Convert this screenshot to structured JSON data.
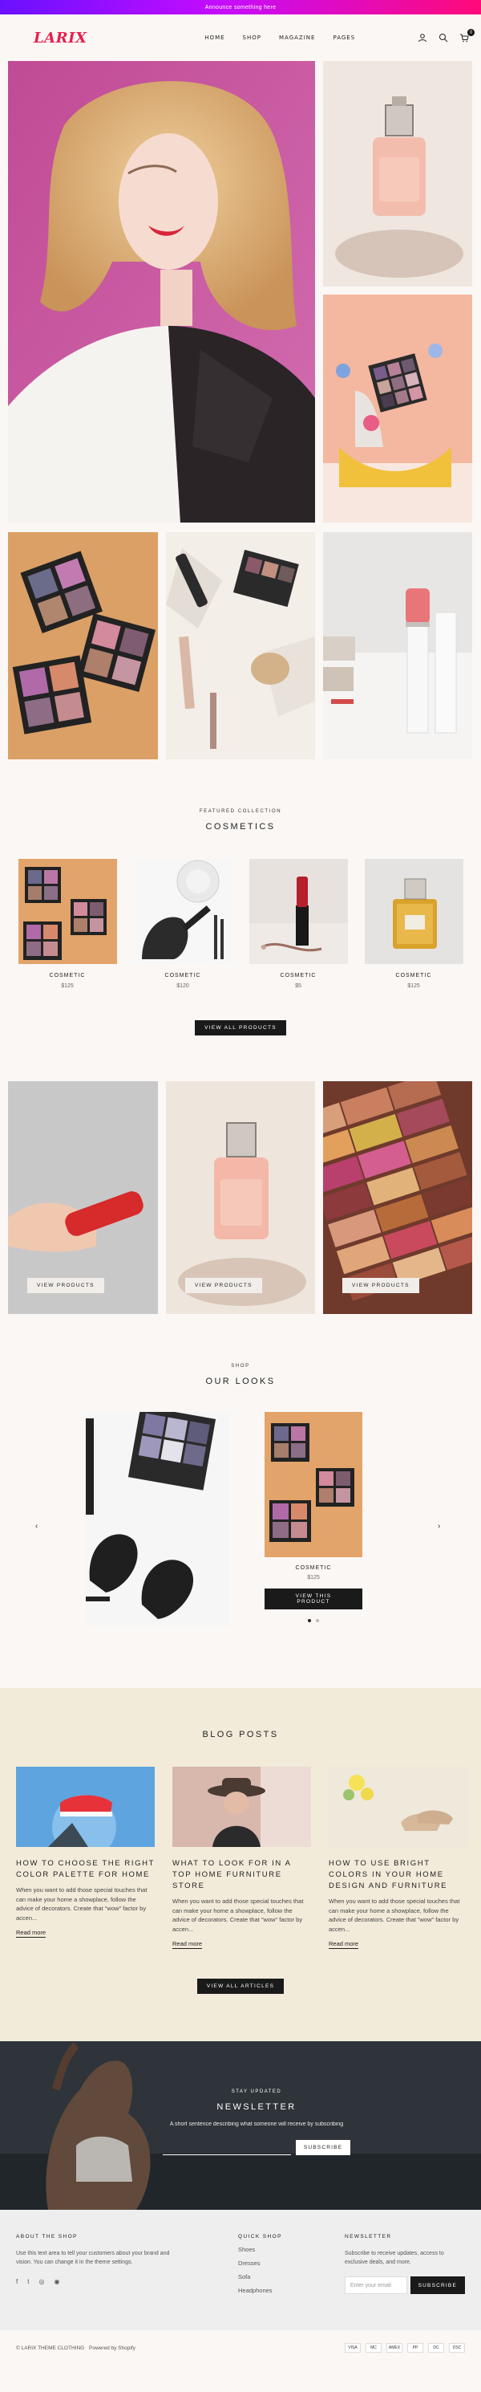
{
  "announcement": "Announce something here",
  "header": {
    "logo": "LARIX",
    "nav": [
      "HOME",
      "SHOP",
      "MAGAZINE",
      "PAGES"
    ],
    "cart_count": "0",
    "icons": [
      "account-icon",
      "search-icon",
      "cart-icon"
    ]
  },
  "featured": {
    "eyebrow": "FEATURED COLLECTION",
    "title": "COSMETICS",
    "products": [
      {
        "name": "COSMETIC",
        "price": "$125"
      },
      {
        "name": "COSMETIC",
        "price": "$120"
      },
      {
        "name": "COSMETIC",
        "price": "$5"
      },
      {
        "name": "COSMETIC",
        "price": "$125"
      }
    ],
    "button": "VIEW ALL PRODUCTS"
  },
  "collections": {
    "buttons": [
      "VIEW PRODUCTS",
      "VIEW PRODUCTS",
      "VIEW PRODUCTS"
    ]
  },
  "looks": {
    "eyebrow": "SHOP",
    "title": "OUR LOOKS",
    "product_name": "COSMETIC",
    "product_price": "$125",
    "button": "VIEW THIS PRODUCT",
    "prev": "‹",
    "next": "›"
  },
  "blog": {
    "title": "BLOG POSTS",
    "posts": [
      {
        "title": "HOW TO CHOOSE THE RIGHT COLOR PALETTE FOR HOME",
        "excerpt": "When you want to add those special touches that can make your home a showplace, follow the advice of decorators. Create that \"wow\" factor by accen...",
        "read_more": "Read more"
      },
      {
        "title": "WHAT TO LOOK FOR IN A TOP HOME FURNITURE STORE",
        "excerpt": "When you want to add those special touches that can make your home a showplace, follow the advice of decorators. Create that \"wow\" factor by accen...",
        "read_more": "Read more"
      },
      {
        "title": "HOW TO USE BRIGHT COLORS IN YOUR HOME DESIGN AND FURNITURE",
        "excerpt": "When you want to add those special touches that can make your home a showplace, follow the advice of decorators. Create that \"wow\" factor by accen...",
        "read_more": "Read more"
      }
    ],
    "button": "VIEW ALL ARTICLES"
  },
  "newsletter": {
    "eyebrow": "STAY UPDATED",
    "title": "NEWSLETTER",
    "text": "A short sentence describing what someone will receive by subscribing",
    "placeholder": "",
    "button": "SUBSCRIBE"
  },
  "footer": {
    "about_title": "ABOUT THE SHOP",
    "about_text": "Use this text area to tell your customers about your brand and vision. You can change it in the theme settings.",
    "social": [
      "f",
      "t",
      "◎",
      "◉"
    ],
    "quick_title": "QUICK SHOP",
    "quick_links": [
      "Shoes",
      "Dresses",
      "Sofa",
      "Headphones"
    ],
    "news_title": "NEWSLETTER",
    "news_text": "Subscribe to receive updates, access to exclusive deals, and more.",
    "email_placeholder": "Enter your email",
    "news_button": "SUBSCRIBE",
    "copyright": "© LARIX THEME CLOTHING",
    "powered": "Powered by Shopify",
    "payments": [
      "VISA",
      "MC",
      "AMEX",
      "PP",
      "DC",
      "DSC"
    ]
  },
  "colors": {
    "brand": "#e61e4d",
    "announce_gradient": [
      "#6a10ff",
      "#c40cff",
      "#ff0a79"
    ],
    "blog_bg": "#f2ebda",
    "footer_bg": "#eeeeee",
    "page_bg": "#fbf7f4"
  }
}
